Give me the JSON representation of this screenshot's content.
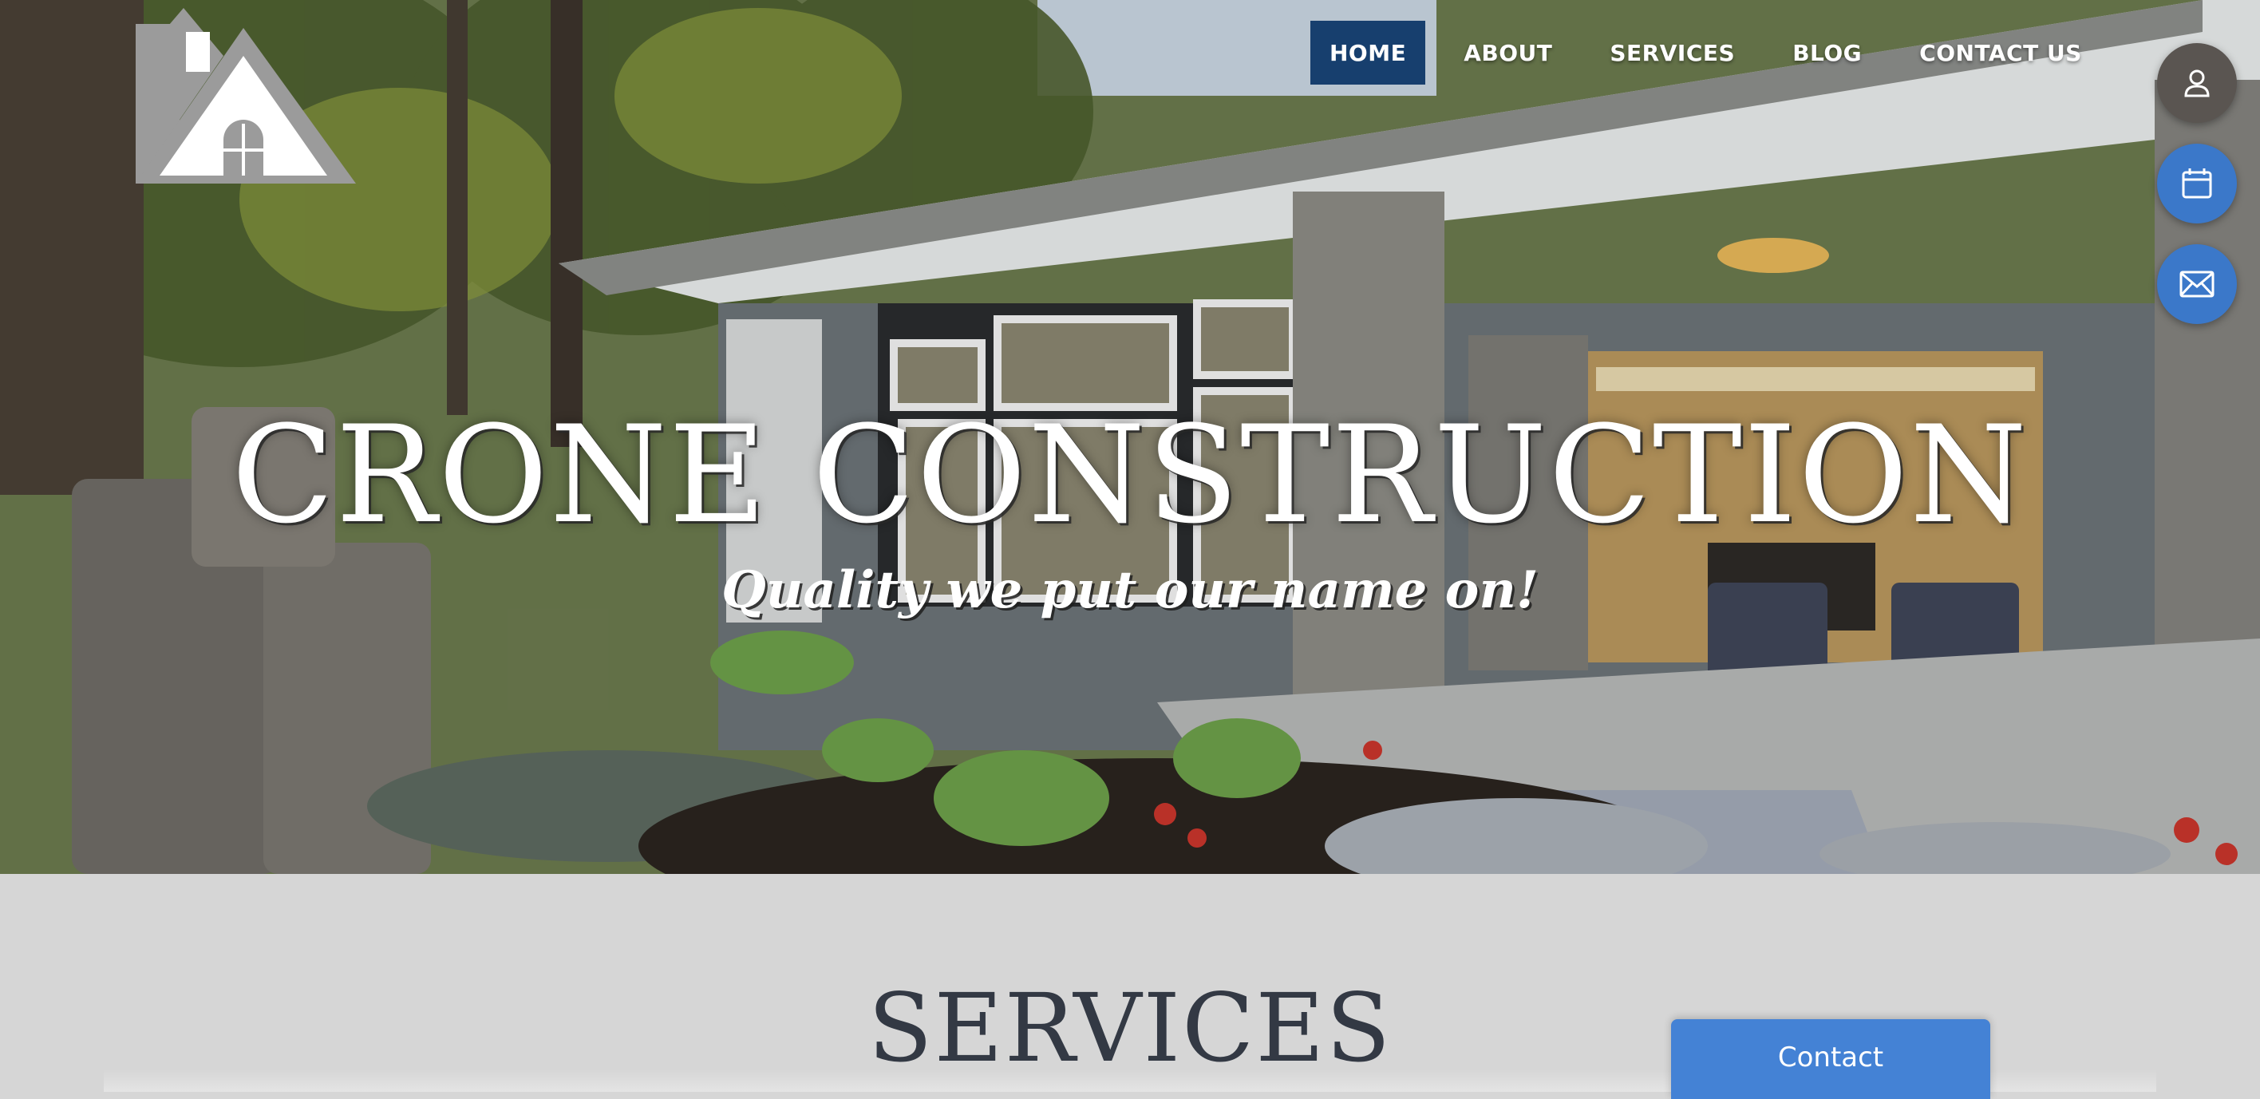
{
  "nav": {
    "items": [
      {
        "label": "HOME",
        "active": true
      },
      {
        "label": "ABOUT",
        "active": false
      },
      {
        "label": "SERVICES",
        "active": false
      },
      {
        "label": "BLOG",
        "active": false
      },
      {
        "label": "CONTACT US",
        "active": false
      }
    ]
  },
  "hero": {
    "title": "CRONE CONSTRUCTION",
    "tagline": "Quality we put our name on!"
  },
  "side_actions": [
    {
      "icon": "user-icon"
    },
    {
      "icon": "calendar-icon"
    },
    {
      "icon": "mail-icon"
    }
  ],
  "services": {
    "title": "SERVICES"
  },
  "contact_widget": {
    "label": "Contact"
  },
  "colors": {
    "nav_active": "#173f6e",
    "accent_blue": "#3b78c9",
    "contact_button": "#4482d5",
    "page_bg": "#d6d6d6",
    "heading": "#333944"
  }
}
